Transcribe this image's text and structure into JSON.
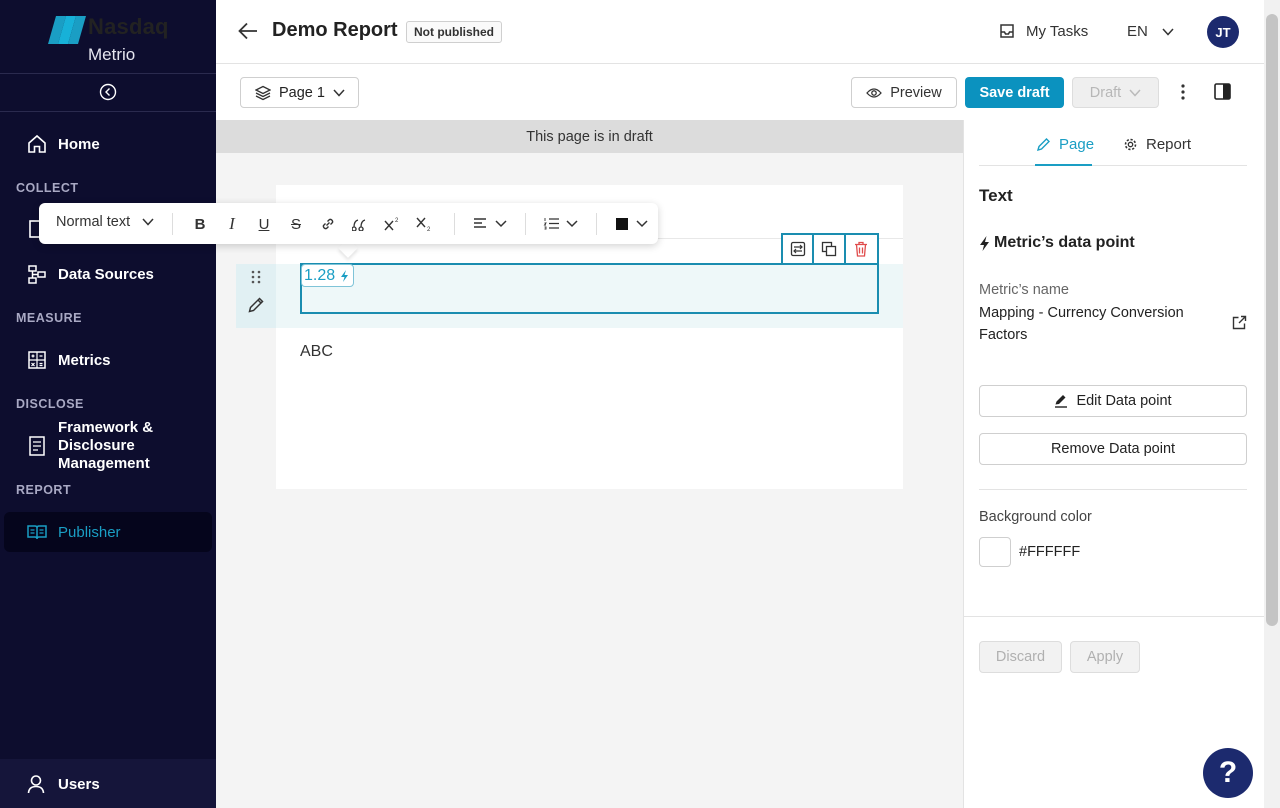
{
  "brand": {
    "name": "Nasdaq",
    "product": "Metrio"
  },
  "sidebar": {
    "items": [
      {
        "label": "Home"
      },
      {
        "label": "Data Sources"
      },
      {
        "label": "Metrics"
      },
      {
        "label": "Framework &"
      },
      {
        "label": "Disclosure"
      },
      {
        "label": "Management"
      },
      {
        "label": "Publisher"
      },
      {
        "label": "Users"
      }
    ],
    "sections": [
      "COLLECT",
      "MEASURE",
      "DISCLOSE",
      "REPORT"
    ]
  },
  "header": {
    "title": "Demo Report",
    "status": "Not published",
    "tasks_label": "My Tasks",
    "language": "EN",
    "avatar_initials": "JT"
  },
  "toolbar": {
    "page_select": "Page 1",
    "preview_label": "Preview",
    "save_label": "Save draft",
    "draft_label": "Draft"
  },
  "banner": "This page is in draft",
  "editor": {
    "style_select": "Normal text",
    "data_point_value": "1.28",
    "text_block": "ABC",
    "format_buttons": [
      "B",
      "I",
      "U",
      "S"
    ]
  },
  "panel": {
    "tabs": [
      {
        "label": "Page"
      },
      {
        "label": "Report"
      }
    ],
    "heading": "Text",
    "dp_heading": "Metric’s data point",
    "metric_name_label": "Metric’s name",
    "metric_name_value": "Mapping - Currency Conversion Factors",
    "edit_btn": "Edit Data point",
    "remove_btn": "Remove Data point",
    "bg_label": "Background color",
    "bg_value": "#FFFFFF",
    "discard_btn": "Discard",
    "apply_btn": "Apply"
  },
  "help": "?",
  "colors": {
    "sidebar_bg": "#0d0d2e",
    "accent": "#0b92bf",
    "brand_mark": "#1a9ec4",
    "avatar_bg": "#1c2a6e"
  }
}
